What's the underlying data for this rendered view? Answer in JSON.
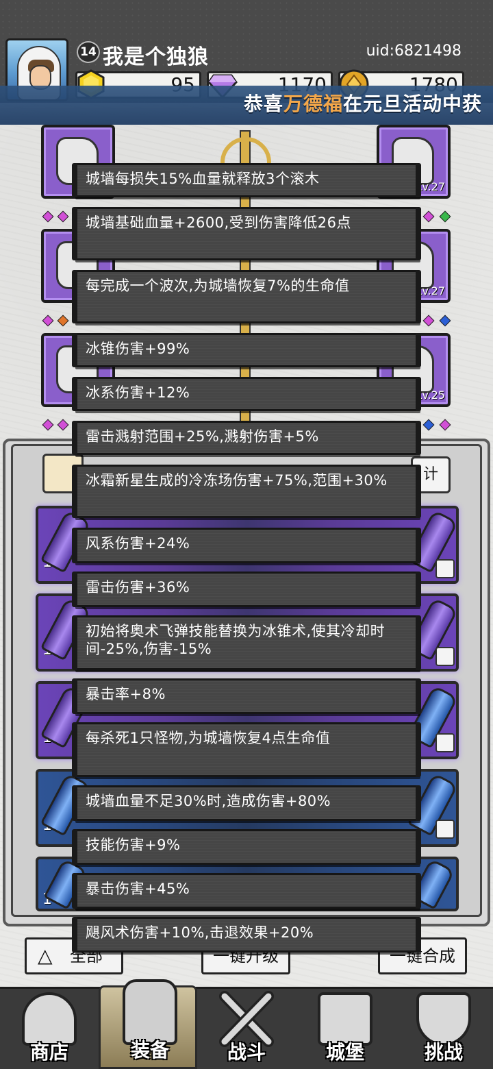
{
  "player": {
    "level": "14",
    "name": "我是个独狼",
    "uid": "uid:6821498"
  },
  "resources": [
    {
      "name": "energy",
      "icon": "hexagon-coin-icon",
      "value": "95",
      "color": "#f5d21f"
    },
    {
      "name": "diamond",
      "icon": "diamond-icon",
      "value": "1170",
      "color": "#b47be6"
    },
    {
      "name": "gold",
      "icon": "gold-coin-icon",
      "value": "1780",
      "color": "#e3a526"
    }
  ],
  "banner": {
    "prefix": "恭喜",
    "highlight": "万德福",
    "suffix": "在元旦活动中获"
  },
  "equipment_levels": {
    "right_top": "Lv.27",
    "right_mid": "Lv.27",
    "right_bot": "Lv.25"
  },
  "panel": {
    "right_tab_fragment": "计",
    "inventory_counts": [
      "1",
      "1",
      "1",
      "1",
      "1"
    ],
    "buttons": {
      "all_label": "全部",
      "upgrade_label": "一键升级",
      "merge_label": "一键合成"
    }
  },
  "buffs": [
    "城墙每损失15%血量就释放3个滚木",
    "城墙基础血量+2600,受到伤害降低26点",
    "每完成一个波次,为城墙恢复7%的生命值",
    "冰锥伤害+99%",
    "冰系伤害+12%",
    "雷击溅射范围+25%,溅射伤害+5%",
    "冰霜新星生成的冷冻场伤害+75%,范围+30%",
    "风系伤害+24%",
    "雷击伤害+36%",
    "初始将奥术飞弹技能替换为冰锥术,使其冷却时间-25%,伤害-15%",
    "暴击率+8%",
    "每杀死1只怪物,为城墙恢复4点生命值",
    "城墙血量不足30%时,造成伤害+80%",
    "技能伤害+9%",
    "暴击伤害+45%",
    "飓风术伤害+10%,击退效果+20%"
  ],
  "nav": [
    {
      "label": "商店",
      "icon": "shop-icon"
    },
    {
      "label": "装备",
      "icon": "backpack-icon",
      "active": true
    },
    {
      "label": "战斗",
      "icon": "crossed-swords-icon"
    },
    {
      "label": "城堡",
      "icon": "castle-icon"
    },
    {
      "label": "挑战",
      "icon": "shield-icon"
    }
  ]
}
